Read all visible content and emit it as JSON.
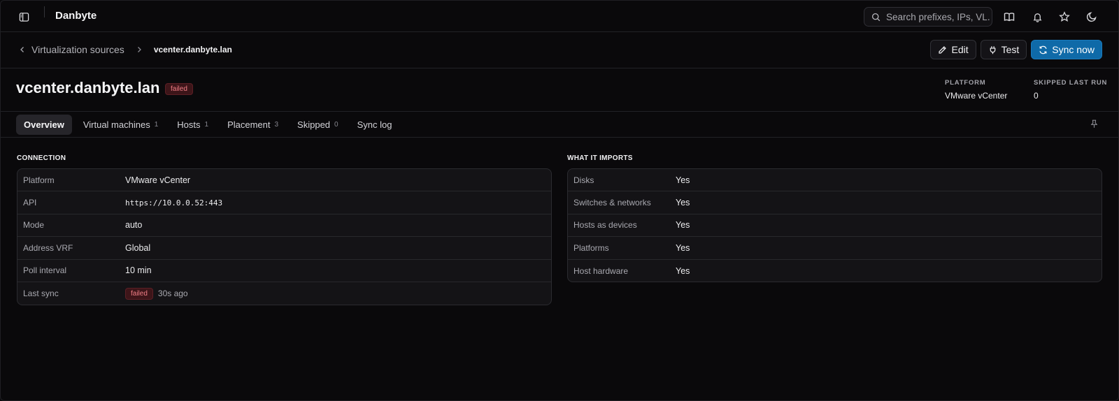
{
  "app": {
    "brand": "Danbyte"
  },
  "search": {
    "placeholder": "Search prefixes, IPs, VL..."
  },
  "breadcrumb": {
    "parent": "Virtualization sources",
    "current": "vcenter.danbyte.lan"
  },
  "actions": {
    "edit": "Edit",
    "test": "Test",
    "sync": "Sync now"
  },
  "header": {
    "title": "vcenter.danbyte.lan",
    "status": "failed",
    "meta": [
      {
        "label": "PLATFORM",
        "value": "VMware vCenter"
      },
      {
        "label": "SKIPPED LAST RUN",
        "value": "0"
      }
    ]
  },
  "tabs": [
    {
      "label": "Overview",
      "count": ""
    },
    {
      "label": "Virtual machines",
      "count": "1"
    },
    {
      "label": "Hosts",
      "count": "1"
    },
    {
      "label": "Placement",
      "count": "3"
    },
    {
      "label": "Skipped",
      "count": "0"
    },
    {
      "label": "Sync log",
      "count": ""
    }
  ],
  "connection": {
    "title": "CONNECTION",
    "rows": [
      {
        "label": "Platform",
        "value": "VMware vCenter"
      },
      {
        "label": "API",
        "value": "https://10.0.0.52:443"
      },
      {
        "label": "Mode",
        "value": "auto"
      },
      {
        "label": "Address VRF",
        "value": "Global"
      },
      {
        "label": "Poll interval",
        "value": "10 min"
      },
      {
        "label": "Last sync",
        "badge": "failed",
        "value": "30s ago"
      }
    ]
  },
  "imports": {
    "title": "WHAT IT IMPORTS",
    "rows": [
      {
        "label": "Disks",
        "value": "Yes"
      },
      {
        "label": "Switches & networks",
        "value": "Yes"
      },
      {
        "label": "Hosts as devices",
        "value": "Yes"
      },
      {
        "label": "Platforms",
        "value": "Yes"
      },
      {
        "label": "Host hardware",
        "value": "Yes"
      }
    ]
  },
  "colors": {
    "accent": "#0f6aa8",
    "danger_bg": "#3d1519",
    "danger_fg": "#f07e86",
    "background": "#0a090b"
  }
}
